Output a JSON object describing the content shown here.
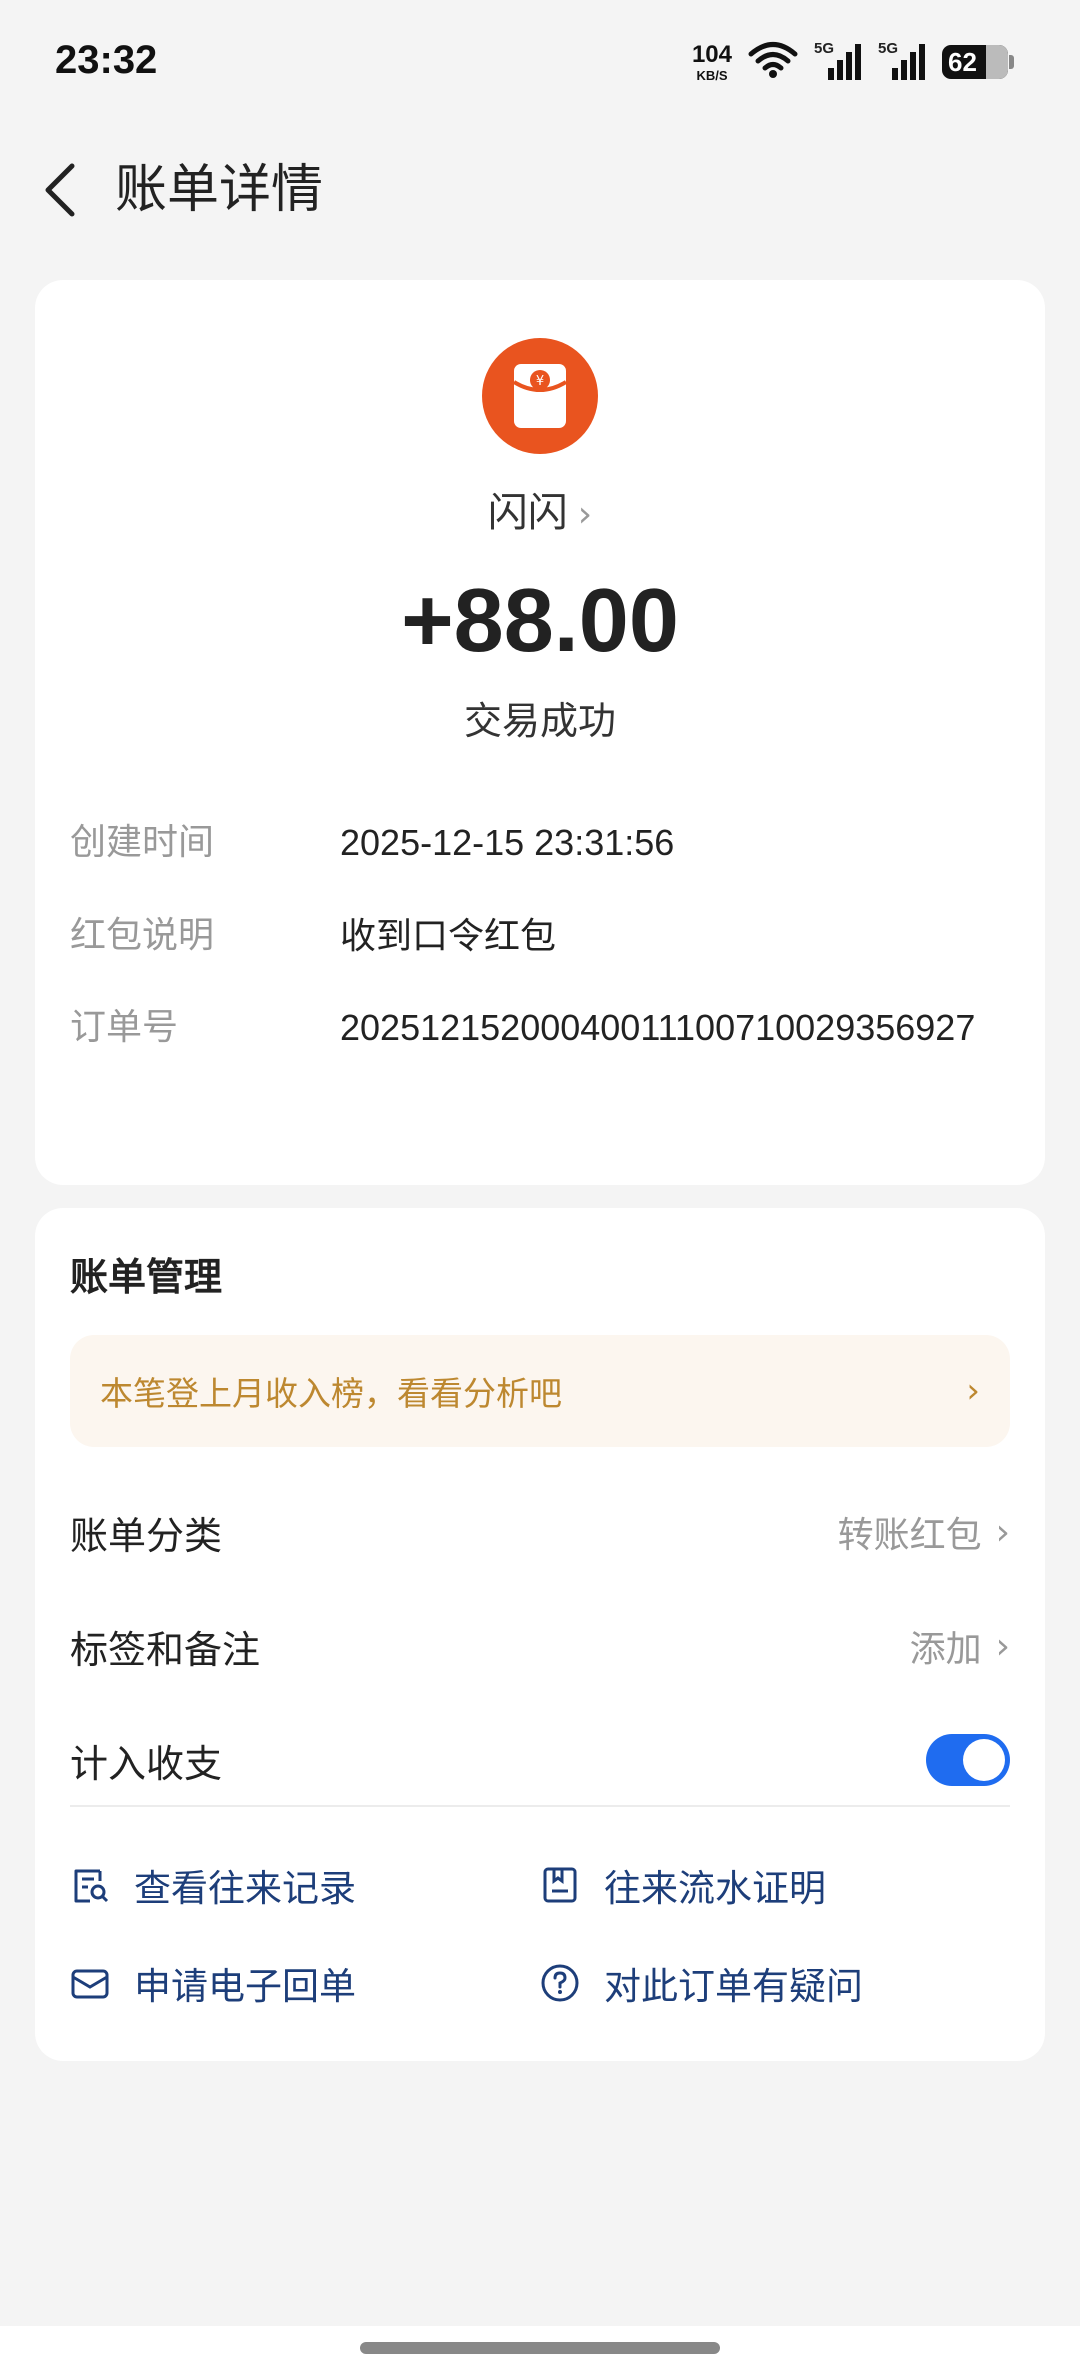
{
  "status_bar": {
    "time": "23:32",
    "net_speed_value": "104",
    "net_speed_unit": "KB/S",
    "signal1_tag": "5G",
    "signal2_tag": "5G",
    "battery": "62",
    "battery_level": 0.62
  },
  "nav": {
    "title": "账单详情",
    "back_icon": "chevron-left-icon"
  },
  "transaction": {
    "avatar_icon": "red-envelope-icon",
    "avatar_color": "#e9541f",
    "payer_name": "闪闪",
    "amount": "+88.00",
    "status": "交易成功",
    "details": [
      {
        "label": "创建时间",
        "value": "2025-12-15 23:31:56"
      },
      {
        "label": "红包说明",
        "value": "收到口令红包"
      },
      {
        "label": "订单号",
        "value": "20251215200040011100710029356927"
      }
    ]
  },
  "management": {
    "title": "账单管理",
    "banner_text": "本笔登上月收入榜，看看分析吧",
    "rows": [
      {
        "label": "账单分类",
        "value": "转账红包"
      },
      {
        "label": "标签和备注",
        "value": "添加"
      },
      {
        "label": "计入收支",
        "toggle_on": true
      }
    ],
    "links": [
      {
        "label": "查看往来记录",
        "icon": "record-search-icon"
      },
      {
        "label": "往来流水证明",
        "icon": "certificate-icon"
      },
      {
        "label": "申请电子回单",
        "icon": "envelope-icon"
      },
      {
        "label": "对此订单有疑问",
        "icon": "question-circle-icon"
      }
    ],
    "accent_color": "#1f6cf0",
    "link_color": "#1d3e7a",
    "banner_color": "#bd8830"
  }
}
